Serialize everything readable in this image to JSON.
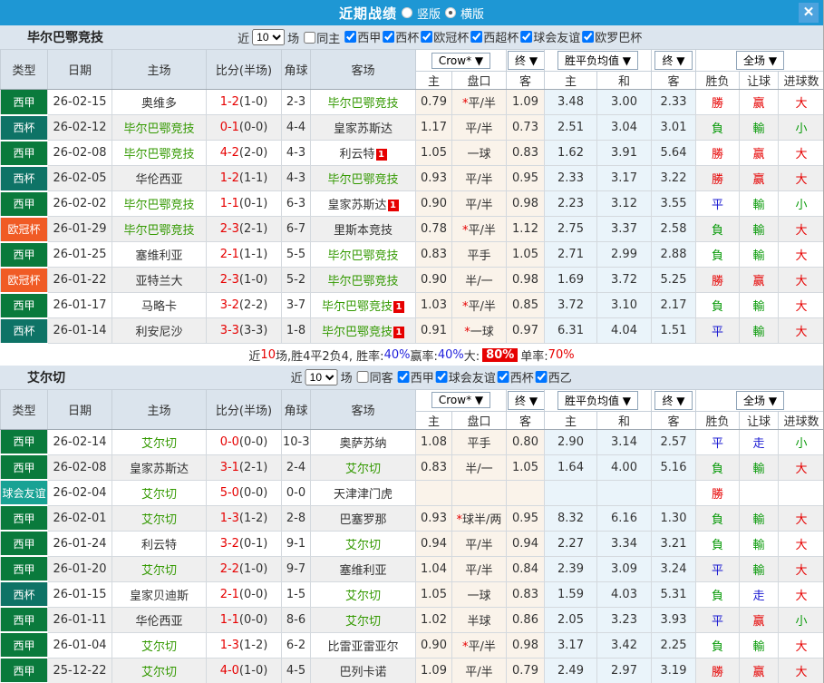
{
  "titlebar": {
    "title": "近期战绩",
    "radio_vertical": "竖版",
    "radio_horizontal": "横版",
    "selected_layout": "横版",
    "close_icon": "✕",
    "bar_color": "#1e97d4"
  },
  "filters_common": {
    "near_label": "近",
    "count_value": "10",
    "games_label": "场"
  },
  "table_headers": {
    "type": "类型",
    "date": "日期",
    "home": "主场",
    "score": "比分(半场)",
    "corner": "角球",
    "away": "客场",
    "crow": "Crow* ▼",
    "end1": "终 ▼",
    "wdl_avg": "胜平负均值 ▼",
    "end2": "终 ▼",
    "full": "全场 ▼",
    "h": "主",
    "handicap": "盘口",
    "a": "客",
    "h2": "主",
    "d": "和",
    "a2": "客",
    "wl": "胜负",
    "let_goal": "让球",
    "goals": "进球数"
  },
  "league_colors": {
    "西甲": "#0a7a3c",
    "西杯": "#0e7366",
    "欧冠杯": "#f05b25",
    "球会友谊": "#18a294"
  },
  "result_colors": {
    "勝": "red",
    "負": "green",
    "平": "blue",
    "赢": "red",
    "輸": "green",
    "走": "blue",
    "大": "red",
    "小": "green"
  },
  "sections": [
    {
      "team": "毕尔巴鄂竞技",
      "same_label": "同主",
      "same_checked": false,
      "leagues": [
        "西甲",
        "西杯",
        "欧冠杯",
        "西超杯",
        "球会友谊",
        "欧罗巴杯"
      ],
      "rows": [
        {
          "league": "西甲",
          "date": "26-02-15",
          "home": "奥维多",
          "hg": false,
          "hb": false,
          "score": "1-2",
          "half": "(1-0)",
          "corner": "2-3",
          "away": "毕尔巴鄂竞技",
          "ag": true,
          "ab": false,
          "odds": [
            "0.79",
            "*平/半",
            "1.09"
          ],
          "avg": [
            "3.48",
            "3.00",
            "2.33"
          ],
          "results": [
            "勝",
            "赢",
            "大"
          ]
        },
        {
          "league": "西杯",
          "date": "26-02-12",
          "home": "毕尔巴鄂竞技",
          "hg": true,
          "hb": false,
          "score": "0-1",
          "half": "(0-0)",
          "corner": "4-4",
          "away": "皇家苏斯达",
          "ag": false,
          "ab": false,
          "odds": [
            "1.17",
            "平/半",
            "0.73"
          ],
          "avg": [
            "2.51",
            "3.04",
            "3.01"
          ],
          "results": [
            "負",
            "輸",
            "小"
          ]
        },
        {
          "league": "西甲",
          "date": "26-02-08",
          "home": "毕尔巴鄂竞技",
          "hg": true,
          "hb": false,
          "score": "4-2",
          "half": "(2-0)",
          "corner": "4-3",
          "away": "利云特",
          "ag": false,
          "ab": true,
          "odds": [
            "1.05",
            "一球",
            "0.83"
          ],
          "avg": [
            "1.62",
            "3.91",
            "5.64"
          ],
          "results": [
            "勝",
            "赢",
            "大"
          ]
        },
        {
          "league": "西杯",
          "date": "26-02-05",
          "home": "华伦西亚",
          "hg": false,
          "hb": false,
          "score": "1-2",
          "half": "(1-1)",
          "corner": "4-3",
          "away": "毕尔巴鄂竞技",
          "ag": true,
          "ab": false,
          "odds": [
            "0.93",
            "平/半",
            "0.95"
          ],
          "avg": [
            "2.33",
            "3.17",
            "3.22"
          ],
          "results": [
            "勝",
            "赢",
            "大"
          ]
        },
        {
          "league": "西甲",
          "date": "26-02-02",
          "home": "毕尔巴鄂竞技",
          "hg": true,
          "hb": false,
          "score": "1-1",
          "half": "(0-1)",
          "corner": "6-3",
          "away": "皇家苏斯达",
          "ag": false,
          "ab": true,
          "odds": [
            "0.90",
            "平/半",
            "0.98"
          ],
          "avg": [
            "2.23",
            "3.12",
            "3.55"
          ],
          "results": [
            "平",
            "輸",
            "小"
          ]
        },
        {
          "league": "欧冠杯",
          "date": "26-01-29",
          "home": "毕尔巴鄂竞技",
          "hg": true,
          "hb": false,
          "score": "2-3",
          "half": "(2-1)",
          "corner": "6-7",
          "away": "里斯本竞技",
          "ag": false,
          "ab": false,
          "odds": [
            "0.78",
            "*平/半",
            "1.12"
          ],
          "avg": [
            "2.75",
            "3.37",
            "2.58"
          ],
          "results": [
            "負",
            "輸",
            "大"
          ]
        },
        {
          "league": "西甲",
          "date": "26-01-25",
          "home": "塞维利亚",
          "hg": false,
          "hb": false,
          "score": "2-1",
          "half": "(1-1)",
          "corner": "5-5",
          "away": "毕尔巴鄂竞技",
          "ag": true,
          "ab": false,
          "odds": [
            "0.83",
            "平手",
            "1.05"
          ],
          "avg": [
            "2.71",
            "2.99",
            "2.88"
          ],
          "results": [
            "負",
            "輸",
            "大"
          ]
        },
        {
          "league": "欧冠杯",
          "date": "26-01-22",
          "home": "亚特兰大",
          "hg": false,
          "hb": false,
          "score": "2-3",
          "half": "(1-0)",
          "corner": "5-2",
          "away": "毕尔巴鄂竞技",
          "ag": true,
          "ab": false,
          "odds": [
            "0.90",
            "半/一",
            "0.98"
          ],
          "avg": [
            "1.69",
            "3.72",
            "5.25"
          ],
          "results": [
            "勝",
            "赢",
            "大"
          ]
        },
        {
          "league": "西甲",
          "date": "26-01-17",
          "home": "马略卡",
          "hg": false,
          "hb": false,
          "score": "3-2",
          "half": "(2-2)",
          "corner": "3-7",
          "away": "毕尔巴鄂竞技",
          "ag": true,
          "ab": true,
          "odds": [
            "1.03",
            "*平/半",
            "0.85"
          ],
          "avg": [
            "3.72",
            "3.10",
            "2.17"
          ],
          "results": [
            "負",
            "輸",
            "大"
          ]
        },
        {
          "league": "西杯",
          "date": "26-01-14",
          "home": "利安尼沙",
          "hg": false,
          "hb": false,
          "score": "3-3",
          "half": "(3-3)",
          "corner": "1-8",
          "away": "毕尔巴鄂竞技",
          "ag": true,
          "ab": true,
          "odds": [
            "0.91",
            "*一球",
            "0.97"
          ],
          "avg": [
            "6.31",
            "4.04",
            "1.51"
          ],
          "results": [
            "平",
            "輸",
            "大"
          ]
        }
      ],
      "summary": [
        {
          "t": "近",
          "c": "k"
        },
        {
          "t": "10",
          "c": "r"
        },
        {
          "t": "场,胜4平2负4, 胜率:",
          "c": "k"
        },
        {
          "t": "40%",
          "c": "b"
        },
        {
          "t": " 赢率:",
          "c": "k"
        },
        {
          "t": "40%",
          "c": "b"
        },
        {
          "t": " 大:",
          "c": "k"
        },
        {
          "t": "80%",
          "c": "hl"
        },
        {
          "t": " 单率:",
          "c": "k"
        },
        {
          "t": "70%",
          "c": "r"
        }
      ]
    },
    {
      "team": "艾尔切",
      "same_label": "同客",
      "same_checked": false,
      "leagues": [
        "西甲",
        "球会友谊",
        "西杯",
        "西乙"
      ],
      "rows": [
        {
          "league": "西甲",
          "date": "26-02-14",
          "home": "艾尔切",
          "hg": true,
          "hb": false,
          "score": "0-0",
          "half": "(0-0)",
          "corner": "10-3",
          "away": "奥萨苏纳",
          "ag": false,
          "ab": false,
          "odds": [
            "1.08",
            "平手",
            "0.80"
          ],
          "avg": [
            "2.90",
            "3.14",
            "2.57"
          ],
          "results": [
            "平",
            "走",
            "小"
          ]
        },
        {
          "league": "西甲",
          "date": "26-02-08",
          "home": "皇家苏斯达",
          "hg": false,
          "hb": false,
          "score": "3-1",
          "half": "(2-1)",
          "corner": "2-4",
          "away": "艾尔切",
          "ag": true,
          "ab": false,
          "odds": [
            "0.83",
            "半/一",
            "1.05"
          ],
          "avg": [
            "1.64",
            "4.00",
            "5.16"
          ],
          "results": [
            "負",
            "輸",
            "大"
          ]
        },
        {
          "league": "球会友谊",
          "date": "26-02-04",
          "home": "艾尔切",
          "hg": true,
          "hb": false,
          "score": "5-0",
          "half": "(0-0)",
          "corner": "0-0",
          "away": "天津津门虎",
          "ag": false,
          "ab": false,
          "odds": [
            "",
            "",
            ""
          ],
          "avg": [
            "",
            "",
            ""
          ],
          "results": [
            "勝",
            "",
            ""
          ]
        },
        {
          "league": "西甲",
          "date": "26-02-01",
          "home": "艾尔切",
          "hg": true,
          "hb": false,
          "score": "1-3",
          "half": "(1-2)",
          "corner": "2-8",
          "away": "巴塞罗那",
          "ag": false,
          "ab": false,
          "odds": [
            "0.93",
            "*球半/两",
            "0.95"
          ],
          "avg": [
            "8.32",
            "6.16",
            "1.30"
          ],
          "results": [
            "負",
            "輸",
            "大"
          ]
        },
        {
          "league": "西甲",
          "date": "26-01-24",
          "home": "利云特",
          "hg": false,
          "hb": false,
          "score": "3-2",
          "half": "(0-1)",
          "corner": "9-1",
          "away": "艾尔切",
          "ag": true,
          "ab": false,
          "odds": [
            "0.94",
            "平/半",
            "0.94"
          ],
          "avg": [
            "2.27",
            "3.34",
            "3.21"
          ],
          "results": [
            "負",
            "輸",
            "大"
          ]
        },
        {
          "league": "西甲",
          "date": "26-01-20",
          "home": "艾尔切",
          "hg": true,
          "hb": false,
          "score": "2-2",
          "half": "(1-0)",
          "corner": "9-7",
          "away": "塞维利亚",
          "ag": false,
          "ab": false,
          "odds": [
            "1.04",
            "平/半",
            "0.84"
          ],
          "avg": [
            "2.39",
            "3.09",
            "3.24"
          ],
          "results": [
            "平",
            "輸",
            "大"
          ]
        },
        {
          "league": "西杯",
          "date": "26-01-15",
          "home": "皇家贝迪斯",
          "hg": false,
          "hb": false,
          "score": "2-1",
          "half": "(0-0)",
          "corner": "1-5",
          "away": "艾尔切",
          "ag": true,
          "ab": false,
          "odds": [
            "1.05",
            "一球",
            "0.83"
          ],
          "avg": [
            "1.59",
            "4.03",
            "5.31"
          ],
          "results": [
            "負",
            "走",
            "大"
          ]
        },
        {
          "league": "西甲",
          "date": "26-01-11",
          "home": "华伦西亚",
          "hg": false,
          "hb": false,
          "score": "1-1",
          "half": "(0-0)",
          "corner": "8-6",
          "away": "艾尔切",
          "ag": true,
          "ab": false,
          "odds": [
            "1.02",
            "半球",
            "0.86"
          ],
          "avg": [
            "2.05",
            "3.23",
            "3.93"
          ],
          "results": [
            "平",
            "赢",
            "小"
          ]
        },
        {
          "league": "西甲",
          "date": "26-01-04",
          "home": "艾尔切",
          "hg": true,
          "hb": false,
          "score": "1-3",
          "half": "(1-2)",
          "corner": "6-2",
          "away": "比雷亚雷亚尔",
          "ag": false,
          "ab": false,
          "odds": [
            "0.90",
            "*平/半",
            "0.98"
          ],
          "avg": [
            "3.17",
            "3.42",
            "2.25"
          ],
          "results": [
            "負",
            "輸",
            "大"
          ]
        },
        {
          "league": "西甲",
          "date": "25-12-22",
          "home": "艾尔切",
          "hg": true,
          "hb": false,
          "score": "4-0",
          "half": "(1-0)",
          "corner": "4-5",
          "away": "巴列卡诺",
          "ag": false,
          "ab": false,
          "odds": [
            "1.09",
            "平/半",
            "0.79"
          ],
          "avg": [
            "2.49",
            "2.97",
            "3.19"
          ],
          "results": [
            "勝",
            "赢",
            "大"
          ]
        }
      ],
      "summary": null
    }
  ]
}
